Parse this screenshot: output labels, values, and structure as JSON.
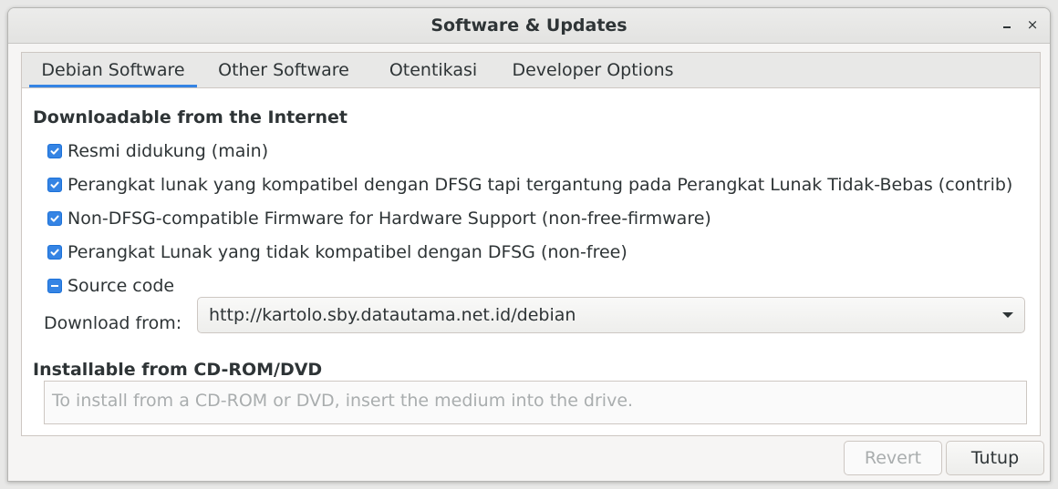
{
  "window": {
    "title": "Software & Updates",
    "minimize_icon": "minimize-icon",
    "close_icon": "close-icon",
    "close_glyph": "×"
  },
  "tabs": [
    {
      "label": "Debian Software",
      "active": true
    },
    {
      "label": "Other Software",
      "active": false
    },
    {
      "label": "Otentikasi",
      "active": false
    },
    {
      "label": "Developer Options",
      "active": false
    }
  ],
  "internet": {
    "heading": "Downloadable from the Internet",
    "options": [
      {
        "label": "Resmi didukung (main)",
        "state": "checked"
      },
      {
        "label": "Perangkat lunak yang kompatibel dengan DFSG tapi tergantung pada Perangkat Lunak Tidak-Bebas (contrib)",
        "state": "checked"
      },
      {
        "label": "Non-DFSG-compatible Firmware for Hardware Support (non-free-firmware)",
        "state": "checked"
      },
      {
        "label": "Perangkat Lunak yang tidak kompatibel dengan DFSG (non-free)",
        "state": "checked"
      },
      {
        "label": "Source code",
        "state": "indeterminate"
      }
    ],
    "download_from_label": "Download from:",
    "download_from_value": "http://kartolo.sby.datautama.net.id/debian"
  },
  "cdrom": {
    "heading": "Installable from CD-ROM/DVD",
    "placeholder": "To install from a CD-ROM or DVD, insert the medium into the drive."
  },
  "buttons": {
    "revert": "Revert",
    "close": "Tutup"
  },
  "colors": {
    "accent": "#3584e4",
    "disabled_text": "#a9adae"
  }
}
